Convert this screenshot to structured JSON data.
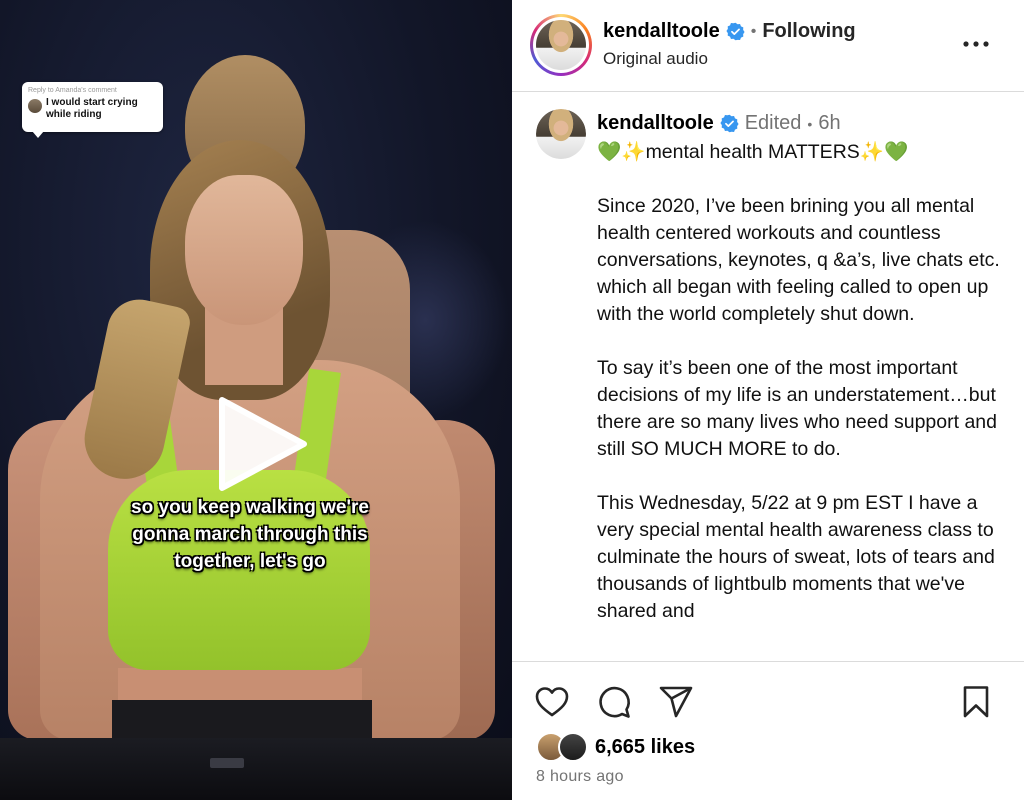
{
  "video": {
    "reply_meta": "Reply to Amanda's comment",
    "reply_text": "I would start crying while riding",
    "caption_line1": "so you keep walking we're",
    "caption_line2": "gonna march through this",
    "caption_line3": "together, let's go",
    "play_icon": "play-icon"
  },
  "header": {
    "username": "kendalltoole",
    "separator": "•",
    "following_label": "Following",
    "audio_label": "Original audio",
    "more_icon": "more-horizontal-icon"
  },
  "caption": {
    "username": "kendalltoole",
    "edited_label": "Edited",
    "separator": "•",
    "time": "6h",
    "headline_prefix": "💚✨",
    "headline_text": "mental health MATTERS",
    "headline_suffix": "✨💚",
    "paragraph1": "Since 2020, I’ve been brining you all mental health centered workouts and countless conversations, keynotes, q &a’s, live chats etc. which all began with feeling called to open up with the world completely shut down.",
    "paragraph2": "To say it’s been one of the most important decisions of my life is an understatement…but there are so many lives who need support and still SO MUCH MORE to do.",
    "paragraph3": "This Wednesday, 5/22 at 9 pm EST I have a very special mental health awareness class to culminate the hours of sweat, lots of tears and thousands of lightbulb moments that we've shared and"
  },
  "actions": {
    "like_icon": "heart-icon",
    "comment_icon": "comment-icon",
    "share_icon": "send-icon",
    "save_icon": "bookmark-icon"
  },
  "footer": {
    "likes": "6,665 likes",
    "posted": "8 hours ago"
  },
  "colors": {
    "verified": "#3897f0",
    "muted": "#737373",
    "border": "#dbdbdb",
    "bra_green": "#a8d63a"
  }
}
